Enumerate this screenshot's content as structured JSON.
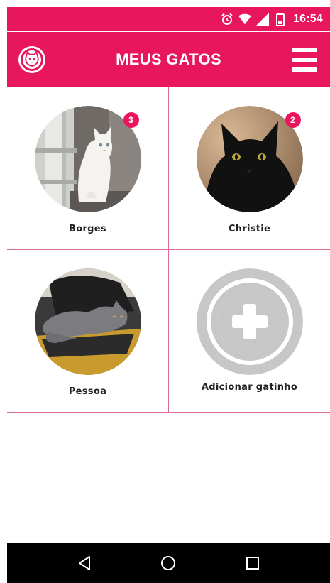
{
  "status_bar": {
    "time": "16:54",
    "icons": [
      "alarm-icon",
      "wifi-icon",
      "signal-icon",
      "battery-icon"
    ]
  },
  "app_bar": {
    "title": "MEUS GATOS",
    "logo_icon": "cat-logo-icon",
    "menu_icon": "hamburger-menu-icon"
  },
  "cats": [
    {
      "name": "Borges",
      "badge": "3",
      "photo": "white-cat-photo"
    },
    {
      "name": "Christie",
      "badge": "2",
      "photo": "black-cat-photo"
    },
    {
      "name": "Pessoa",
      "badge": "",
      "photo": "gray-cat-photo"
    }
  ],
  "add_cat": {
    "label": "Adicionar gatinho",
    "icon": "add-circle-icon"
  },
  "nav_bar": {
    "buttons": [
      "back-icon",
      "home-icon",
      "recents-icon"
    ]
  },
  "colors": {
    "primary": "#e8175d",
    "divider": "#d9689a",
    "add_icon": "#c7c7c7",
    "nav_bg": "#000000"
  }
}
